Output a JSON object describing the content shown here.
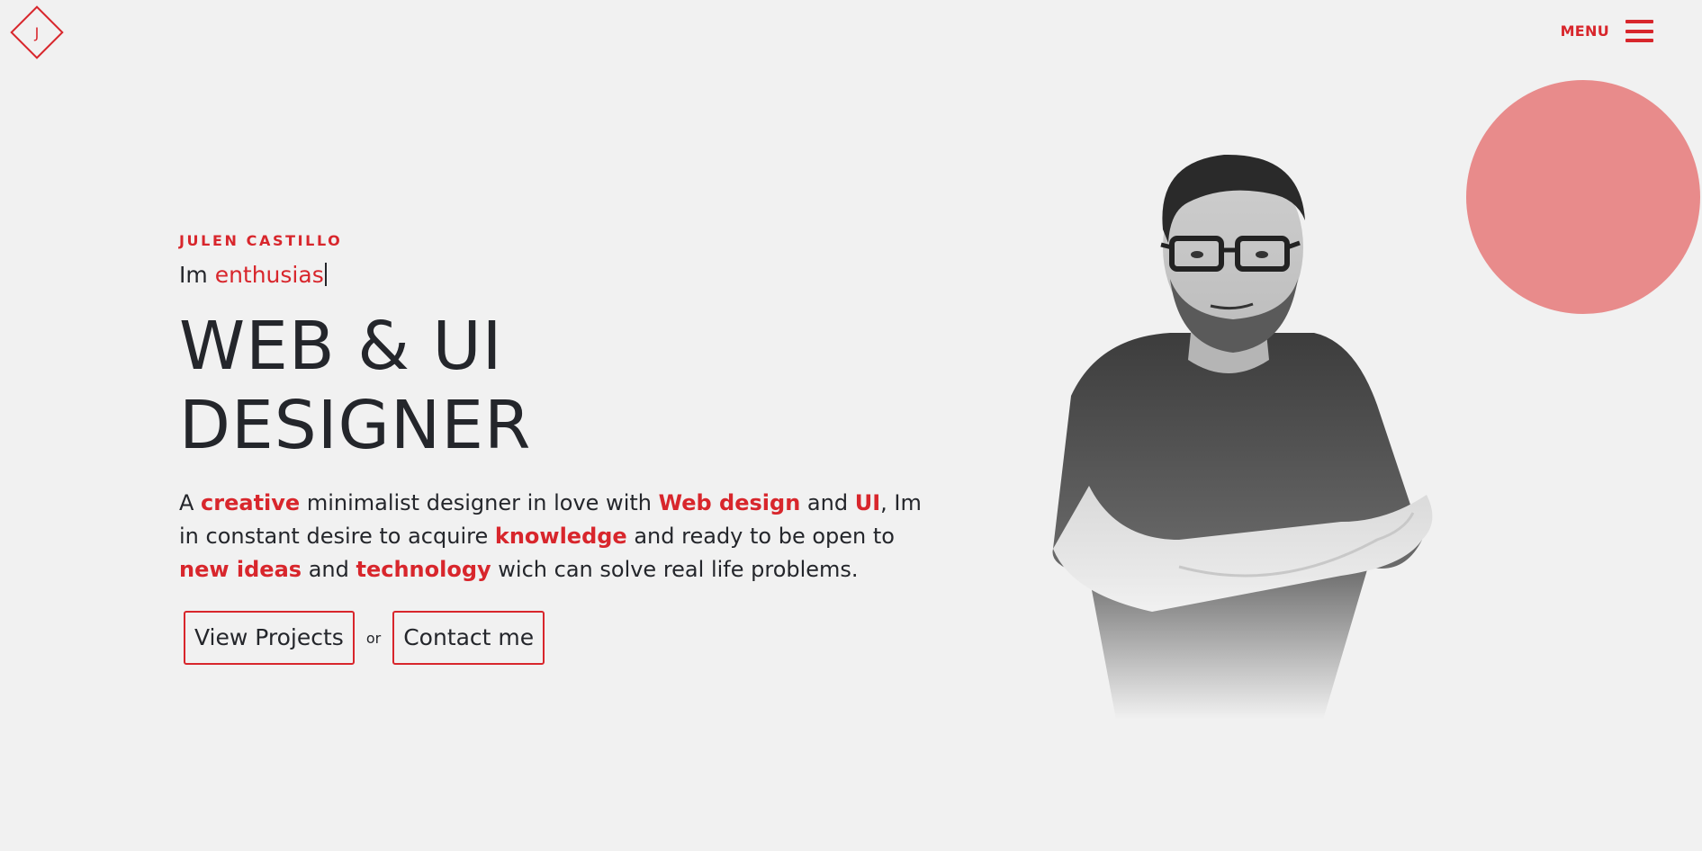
{
  "header": {
    "logo_letter": "J",
    "menu_label": "MENU"
  },
  "hero": {
    "name": "JULEN CASTILLO",
    "typed_prefix": "Im",
    "typed_word": "enthusias",
    "title_line1": "WEB & UI",
    "title_line2": "DESIGNER",
    "description": {
      "p1": "A ",
      "hl1": "creative",
      "p2": " minimalist designer in love with ",
      "hl2": "Web design",
      "p3": " and ",
      "hl3": "UI",
      "p4": ", Im in constant desire to acquire ",
      "hl4": "knowledge",
      "p5": " and ready to be open to ",
      "hl5": "new ideas",
      "p6": " and ",
      "hl6": "technology",
      "p7": " wich can solve real life problems."
    },
    "buttons": {
      "projects": "View Projects",
      "or": "or",
      "contact": "Contact me"
    }
  },
  "colors": {
    "accent": "#d8262c",
    "circle": "#e88b8b",
    "background": "#f1f1f1",
    "text": "#24262b"
  },
  "icons": {
    "logo": "diamond-logo-icon",
    "menu": "hamburger-icon"
  }
}
